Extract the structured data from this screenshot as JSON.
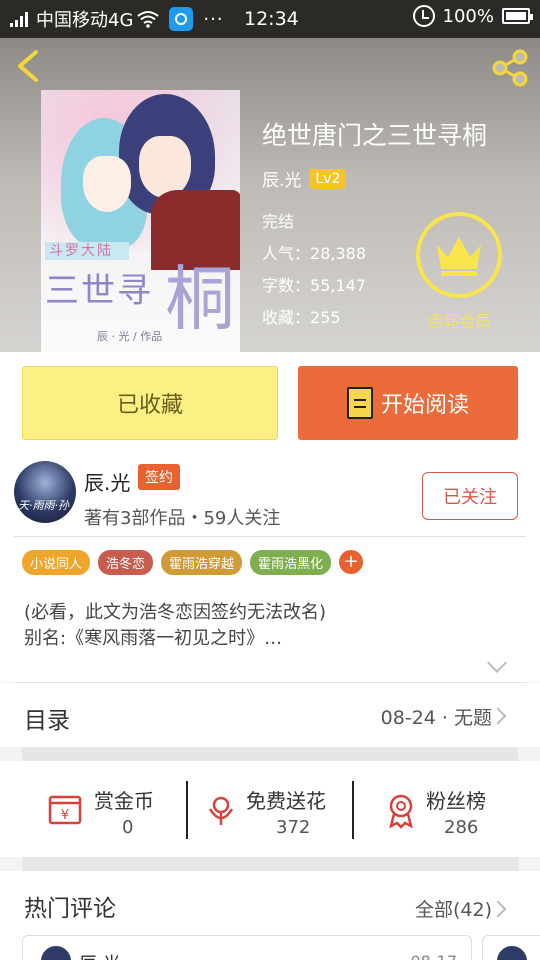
{
  "status_bar": {
    "carrier": "中国移动4G",
    "time": "12:34",
    "battery": "100%",
    "more": "···"
  },
  "book": {
    "title": "绝世唐门之三世寻桐",
    "author": "辰.光",
    "level": "Lv2",
    "state": "完结",
    "popularity_label": "人气：",
    "popularity": "28,388",
    "words_label": "字数：",
    "words": "55,147",
    "favorites_label": "收藏：",
    "favorites": "255",
    "vip_label": "点亮会员",
    "cover_art": {
      "series_text": "斗罗大陆",
      "title_text": "三世寻",
      "big_char": "桐",
      "author_text": "辰 · 光 / 作品"
    }
  },
  "actions": {
    "collect_label": "已收藏",
    "read_label": "开始阅读"
  },
  "author": {
    "name": "辰.光",
    "sign_badge": "签约",
    "stats": "著有3部作品・59人关注",
    "follow_label": "已关注",
    "avatar_text": "天·雨雨·孙"
  },
  "tags": [
    {
      "label": "小说同人",
      "color": "#f0a52c"
    },
    {
      "label": "浩冬恋",
      "color": "#c75d4e"
    },
    {
      "label": "霍雨浩穿越",
      "color": "#d09a34"
    },
    {
      "label": "霍雨浩黑化",
      "color": "#7fae4f"
    }
  ],
  "tags_more": "+",
  "summary": {
    "line1": "(必看，此文为浩冬恋因签约无法改名)",
    "line2": "别名:《寒风雨落一初见之时》…"
  },
  "toc": {
    "label": "目录",
    "latest": "08-24 · 无题"
  },
  "stats": [
    {
      "label": "赏金币",
      "value": "0",
      "icon": "coin-icon"
    },
    {
      "label": "免费送花",
      "value": "372",
      "icon": "flower-icon"
    },
    {
      "label": "粉丝榜",
      "value": "286",
      "icon": "medal-icon"
    }
  ],
  "comments": {
    "title": "热门评论",
    "all_label": "全部(42)",
    "first_name": "辰.光",
    "first_date": "08-17"
  },
  "colors": {
    "accent_orange": "#ec6b3b",
    "collect_yellow": "#fcef84",
    "vip_yellow": "#f8e54c"
  }
}
